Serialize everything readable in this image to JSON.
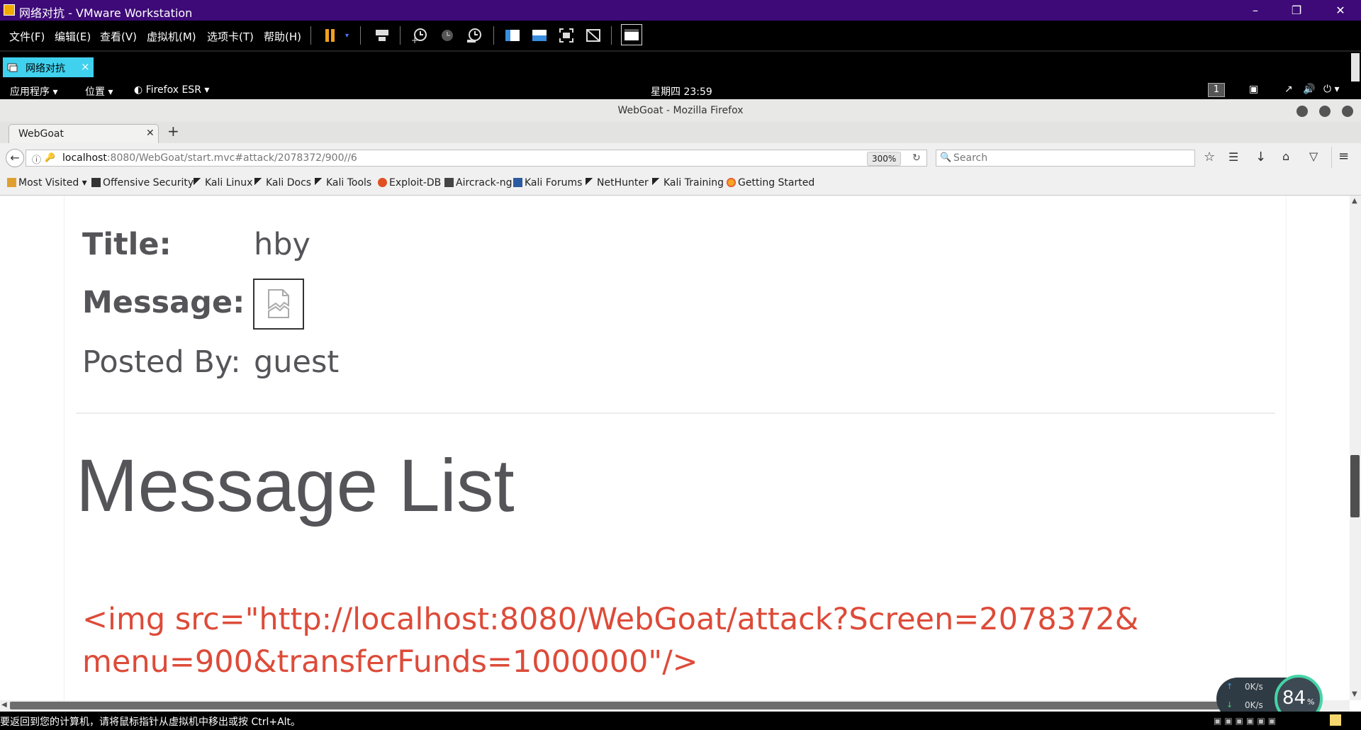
{
  "vmware": {
    "title": "网络对抗 - VMware Workstation",
    "menu": [
      "文件(F)",
      "编辑(E)",
      "查看(V)",
      "虚拟机(M)",
      "选项卡(T)",
      "帮助(H)"
    ],
    "tab_label": "网络对抗",
    "tab_close": "×",
    "status_text": "要返回到您的计算机，请将鼠标指针从虚拟机中移出或按 Ctrl+Alt。"
  },
  "kali_panel": {
    "apps": "应用程序",
    "places": "位置",
    "firefox": "Firefox ESR",
    "clock": "星期四 23:59",
    "workspace": "1"
  },
  "firefox": {
    "window_title": "WebGoat - Mozilla Firefox",
    "tab_title": "WebGoat",
    "new_tab": "+",
    "url_host": "localhost",
    "url_rest": ":8080/WebGoat/start.mvc#attack/2078372/900//6",
    "zoom": "300%",
    "search_placeholder": "Search",
    "bookmarks": [
      {
        "label": "Most Visited",
        "icon": "folder-icon"
      },
      {
        "label": "Offensive Security",
        "icon": "offsec-icon"
      },
      {
        "label": "Kali Linux",
        "icon": "kali-icon"
      },
      {
        "label": "Kali Docs",
        "icon": "kali-icon"
      },
      {
        "label": "Kali Tools",
        "icon": "kali-icon"
      },
      {
        "label": "Exploit-DB",
        "icon": "exploitdb-icon"
      },
      {
        "label": "Aircrack-ng",
        "icon": "aircrack-icon"
      },
      {
        "label": "Kali Forums",
        "icon": "forums-icon"
      },
      {
        "label": "NetHunter",
        "icon": "kali-icon"
      },
      {
        "label": "Kali Training",
        "icon": "kali-icon"
      },
      {
        "label": "Getting Started",
        "icon": "firefox-icon"
      }
    ]
  },
  "page": {
    "title_label": "Title:",
    "title_value": "hby",
    "message_label": "Message:",
    "posted_by_label": "Posted By:",
    "posted_by_value": "guest",
    "list_heading": "Message List",
    "list_item_line1": "<img src=\"http://localhost:8080/WebGoat/attack?Screen=2078372&",
    "list_item_line2": "menu=900&transferFunds=1000000\"/>",
    "link_color": "#dd4b39"
  },
  "net_widget": {
    "up": "0K/s",
    "down": "0K/s",
    "percent": "84",
    "percent_unit": "%"
  }
}
